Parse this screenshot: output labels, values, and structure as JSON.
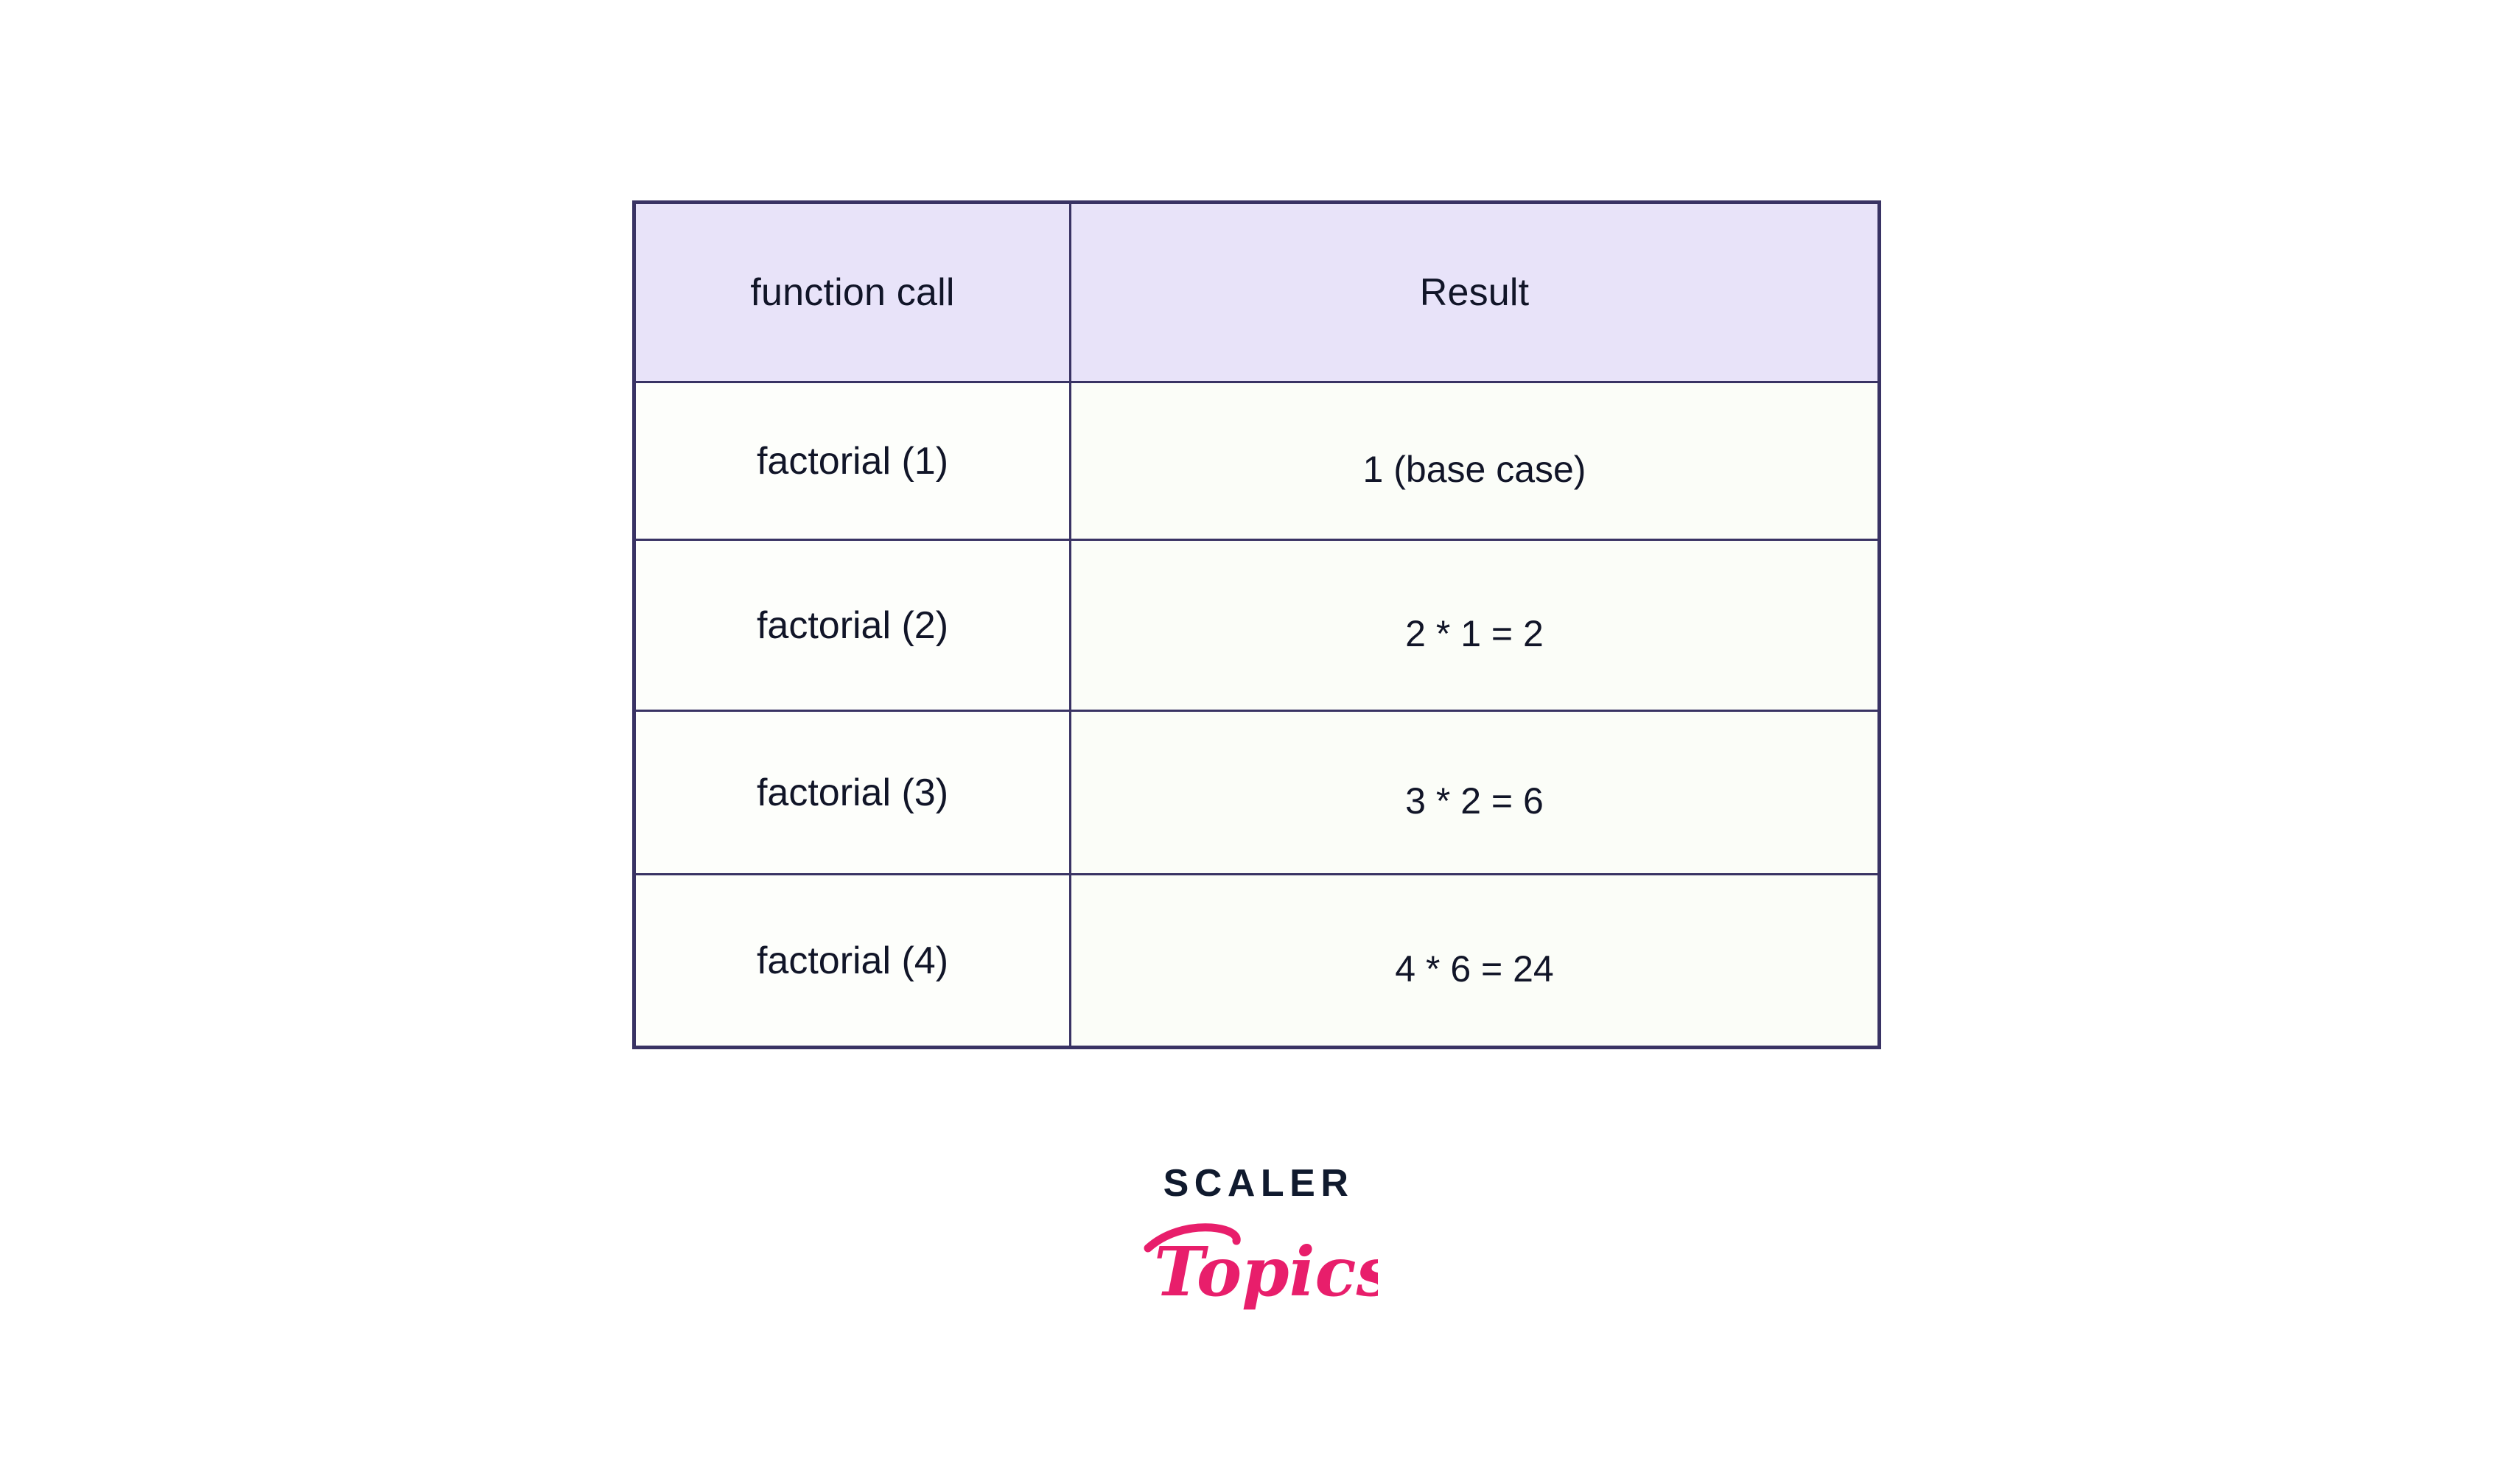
{
  "table": {
    "headers": {
      "function_call": "function call",
      "result": "Result"
    },
    "rows": [
      {
        "call": "factorial (1)",
        "result": "1 (base case)"
      },
      {
        "call": "factorial (2)",
        "result": "2 * 1 = 2"
      },
      {
        "call": "factorial (3)",
        "result": "3 * 2 = 6"
      },
      {
        "call": "factorial (4)",
        "result": "4 * 6 = 24"
      }
    ]
  },
  "logo": {
    "wordmark": "SCALER",
    "script": "Topics",
    "wordmark_color": "#101a2e",
    "script_color": "#e81e6b"
  },
  "colors": {
    "border": "#393364",
    "header_fill": "#e8e3f9",
    "cell_fill": "#fbfdf8",
    "page_background": "#ffffff",
    "text": "#111528"
  }
}
